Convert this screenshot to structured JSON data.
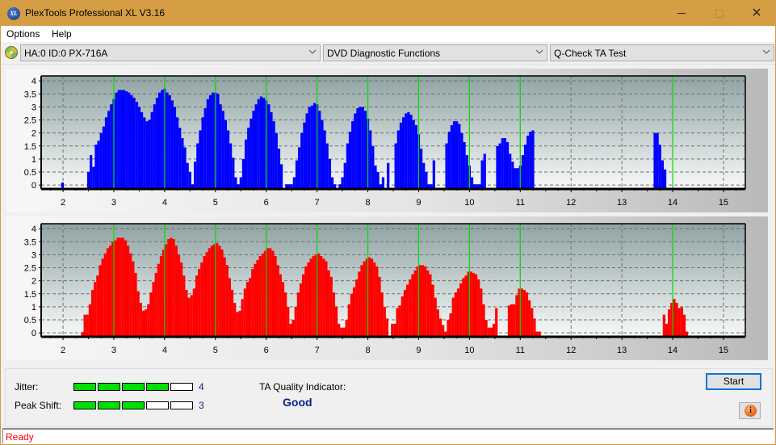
{
  "window": {
    "title": "PlexTools Professional XL V3.16",
    "app_icon": "XL",
    "controls": {
      "minimize": "minimize-icon",
      "maximize": "maximize-icon",
      "close": "×"
    }
  },
  "menu": {
    "items": [
      {
        "label": "Options"
      },
      {
        "label": "Help"
      }
    ]
  },
  "toolbar": {
    "drive": {
      "icon": "disc-drive-icon",
      "value": "HA:0 ID:0  PX-716A"
    },
    "function": {
      "value": "DVD Diagnostic Functions"
    },
    "test": {
      "value": "Q-Check TA Test"
    }
  },
  "results": {
    "jitter": {
      "label": "Jitter:",
      "value": "4",
      "level": 4,
      "max": 5
    },
    "peak_shift": {
      "label": "Peak Shift:",
      "value": "3",
      "level": 3,
      "max": 5
    },
    "ta_quality_label": "TA Quality Indicator:",
    "ta_quality_value": "Good",
    "start_label": "Start",
    "info_icon": "i"
  },
  "status": {
    "text": "Ready"
  },
  "colors": {
    "title_bar": "#d59e43",
    "blue_bars": "#0000ff",
    "red_bars": "#ff0000",
    "reference_lines": "#00e000",
    "meter_on": "#00e000",
    "status_text": "#ff0000",
    "quality_text": "#0d1f8a"
  },
  "chart_data": [
    {
      "type": "bar",
      "title": "",
      "name": "upper-chart",
      "color": "#0000ff",
      "xlabel": "",
      "ylabel": "",
      "xlim": [
        1.57,
        15.43
      ],
      "ylim": [
        -0.15,
        4.19
      ],
      "xticks": [
        2,
        3,
        4,
        5,
        6,
        7,
        8,
        9,
        10,
        11,
        12,
        13,
        14,
        15
      ],
      "yticks": [
        0,
        0.5,
        1,
        1.5,
        2,
        2.5,
        3,
        3.5,
        4
      ],
      "ytick_labels": [
        "0",
        "0.5",
        "1",
        "1.5",
        "2",
        "2.5",
        "3",
        "3.5",
        "4"
      ],
      "grid": true,
      "reference_lines": [
        3,
        4,
        5,
        6,
        7,
        8,
        9,
        10,
        11,
        14
      ],
      "x": [
        1.99,
        2.5,
        2.55,
        2.6,
        2.65,
        2.7,
        2.75,
        2.8,
        2.85,
        2.9,
        2.95,
        3.0,
        3.05,
        3.1,
        3.15,
        3.2,
        3.25,
        3.3,
        3.35,
        3.4,
        3.45,
        3.5,
        3.55,
        3.6,
        3.65,
        3.7,
        3.75,
        3.8,
        3.85,
        3.9,
        3.95,
        4.0,
        4.05,
        4.1,
        4.15,
        4.2,
        4.25,
        4.3,
        4.35,
        4.4,
        4.45,
        4.5,
        4.55,
        4.6,
        4.65,
        4.7,
        4.75,
        4.8,
        4.85,
        4.9,
        4.95,
        5.0,
        5.05,
        5.1,
        5.15,
        5.2,
        5.25,
        5.3,
        5.35,
        5.4,
        5.45,
        5.5,
        5.55,
        5.6,
        5.65,
        5.7,
        5.75,
        5.8,
        5.85,
        5.9,
        5.95,
        6.0,
        6.05,
        6.1,
        6.15,
        6.2,
        6.25,
        6.3,
        6.4,
        6.45,
        6.5,
        6.55,
        6.6,
        6.65,
        6.7,
        6.75,
        6.8,
        6.85,
        6.9,
        6.95,
        7.0,
        7.05,
        7.1,
        7.15,
        7.2,
        7.25,
        7.3,
        7.35,
        7.45,
        7.5,
        7.55,
        7.6,
        7.65,
        7.7,
        7.75,
        7.8,
        7.85,
        7.9,
        7.95,
        8.0,
        8.05,
        8.1,
        8.15,
        8.2,
        8.25,
        8.3,
        8.4,
        8.55,
        8.6,
        8.65,
        8.7,
        8.75,
        8.8,
        8.85,
        8.9,
        8.95,
        9.0,
        9.05,
        9.1,
        9.15,
        9.2,
        9.25,
        9.3,
        9.55,
        9.6,
        9.65,
        9.7,
        9.75,
        9.8,
        9.85,
        9.9,
        9.95,
        10.0,
        10.05,
        10.1,
        10.15,
        10.2,
        10.25,
        10.3,
        10.55,
        10.6,
        10.65,
        10.7,
        10.75,
        10.8,
        10.85,
        10.9,
        10.95,
        11.0,
        11.05,
        11.1,
        11.15,
        11.2,
        11.25,
        13.65,
        13.7,
        13.75,
        13.8,
        13.85,
        13.9,
        13.95,
        14.0,
        14.05,
        14.1,
        14.15
      ],
      "values": [
        0.1,
        0.5,
        1.15,
        0.7,
        1.55,
        1.7,
        2.0,
        2.25,
        2.6,
        2.85,
        3.1,
        3.3,
        3.55,
        3.65,
        3.65,
        3.65,
        3.6,
        3.55,
        3.45,
        3.35,
        3.2,
        3.0,
        2.8,
        2.6,
        2.45,
        2.5,
        2.8,
        3.1,
        3.35,
        3.55,
        3.65,
        3.7,
        3.55,
        3.45,
        3.25,
        3.0,
        2.6,
        2.2,
        1.8,
        1.45,
        0.85,
        0.5,
        0.0,
        0.9,
        1.6,
        2.1,
        2.6,
        2.95,
        3.3,
        3.45,
        3.55,
        3.55,
        3.5,
        3.1,
        2.85,
        2.5,
        2.1,
        1.6,
        1.05,
        0.3,
        0.0,
        0.3,
        1.0,
        1.75,
        2.2,
        2.55,
        2.85,
        3.1,
        3.3,
        3.4,
        3.35,
        3.25,
        3.1,
        2.8,
        2.45,
        2.0,
        1.4,
        0.8,
        0.0,
        0.0,
        0.0,
        0.3,
        0.95,
        1.45,
        2.0,
        2.4,
        2.75,
        3.0,
        3.05,
        3.15,
        3.1,
        2.85,
        2.5,
        2.1,
        1.6,
        1.0,
        0.3,
        0.0,
        0.0,
        0.3,
        0.85,
        1.6,
        2.05,
        2.45,
        2.75,
        2.95,
        3.0,
        3.0,
        2.85,
        2.55,
        2.1,
        1.5,
        0.75,
        0.5,
        0.0,
        0.3,
        0.85,
        1.6,
        2.1,
        2.4,
        2.6,
        2.75,
        2.8,
        2.7,
        2.5,
        2.3,
        1.95,
        1.4,
        0.85,
        0.5,
        0.0,
        0.0,
        0.95,
        1.6,
        2.05,
        2.3,
        2.45,
        2.45,
        2.35,
        2.0,
        1.65,
        1.15,
        0.75,
        0.3,
        0.0,
        0.0,
        0.0,
        0.95,
        1.2,
        1.5,
        1.6,
        1.8,
        1.8,
        1.65,
        1.2,
        0.9,
        0.65,
        0.65,
        0.75,
        1.15,
        1.55,
        1.9,
        2.05,
        2.1,
        2.0,
        2.0,
        1.55,
        0.95,
        0.6
      ]
    },
    {
      "type": "bar",
      "title": "",
      "name": "lower-chart",
      "color": "#ff0000",
      "xlabel": "",
      "ylabel": "",
      "xlim": [
        1.57,
        15.43
      ],
      "ylim": [
        -0.15,
        4.19
      ],
      "xticks": [
        2,
        3,
        4,
        5,
        6,
        7,
        8,
        9,
        10,
        11,
        12,
        13,
        14,
        15
      ],
      "yticks": [
        0,
        0.5,
        1,
        1.5,
        2,
        2.5,
        3,
        3.5,
        4
      ],
      "ytick_labels": [
        "0",
        "0.5",
        "1",
        "1.5",
        "2",
        "2.5",
        "3",
        "3.5",
        "4"
      ],
      "grid": true,
      "reference_lines": [
        3,
        4,
        5,
        6,
        7,
        8,
        9,
        10,
        11,
        14
      ],
      "x": [
        2.38,
        2.43,
        2.48,
        2.53,
        2.58,
        2.63,
        2.68,
        2.73,
        2.78,
        2.83,
        2.88,
        2.93,
        2.98,
        3.03,
        3.08,
        3.13,
        3.18,
        3.23,
        3.28,
        3.33,
        3.38,
        3.43,
        3.48,
        3.53,
        3.58,
        3.63,
        3.68,
        3.73,
        3.78,
        3.83,
        3.88,
        3.93,
        3.98,
        4.03,
        4.08,
        4.13,
        4.18,
        4.23,
        4.28,
        4.33,
        4.38,
        4.43,
        4.48,
        4.53,
        4.58,
        4.63,
        4.68,
        4.73,
        4.78,
        4.83,
        4.88,
        4.93,
        4.98,
        5.03,
        5.08,
        5.13,
        5.18,
        5.23,
        5.28,
        5.33,
        5.38,
        5.43,
        5.48,
        5.53,
        5.58,
        5.63,
        5.68,
        5.73,
        5.78,
        5.83,
        5.88,
        5.93,
        5.98,
        6.03,
        6.08,
        6.13,
        6.18,
        6.23,
        6.28,
        6.33,
        6.38,
        6.43,
        6.48,
        6.53,
        6.58,
        6.63,
        6.68,
        6.73,
        6.78,
        6.83,
        6.88,
        6.93,
        6.98,
        7.03,
        7.08,
        7.13,
        7.18,
        7.23,
        7.28,
        7.33,
        7.38,
        7.43,
        7.48,
        7.53,
        7.58,
        7.63,
        7.68,
        7.73,
        7.78,
        7.83,
        7.88,
        7.93,
        7.98,
        8.03,
        8.08,
        8.13,
        8.18,
        8.23,
        8.28,
        8.33,
        8.38,
        8.48,
        8.53,
        8.58,
        8.63,
        8.68,
        8.73,
        8.78,
        8.83,
        8.88,
        8.93,
        8.98,
        9.03,
        9.08,
        9.13,
        9.18,
        9.23,
        9.28,
        9.33,
        9.38,
        9.43,
        9.48,
        9.53,
        9.58,
        9.63,
        9.68,
        9.73,
        9.78,
        9.83,
        9.88,
        9.93,
        9.98,
        10.03,
        10.08,
        10.13,
        10.18,
        10.23,
        10.28,
        10.33,
        10.38,
        10.43,
        10.48,
        10.53,
        10.78,
        10.83,
        10.88,
        10.93,
        10.98,
        11.03,
        11.08,
        11.13,
        11.18,
        11.23,
        11.28,
        11.33,
        11.38,
        13.83,
        13.88,
        13.93,
        13.98,
        14.03,
        14.08,
        14.13,
        14.18,
        14.23,
        14.28,
        14.33
      ],
      "values": [
        0.0,
        0.7,
        0.7,
        1.1,
        1.65,
        1.95,
        2.2,
        2.6,
        2.85,
        3.05,
        3.25,
        3.35,
        3.5,
        3.55,
        3.65,
        3.65,
        3.65,
        3.55,
        3.35,
        3.05,
        2.75,
        2.3,
        1.6,
        1.15,
        0.85,
        0.9,
        1.1,
        1.55,
        1.95,
        2.3,
        2.65,
        2.95,
        3.2,
        3.4,
        3.6,
        3.65,
        3.6,
        3.35,
        3.0,
        2.7,
        2.2,
        1.65,
        1.35,
        1.45,
        1.7,
        2.2,
        2.45,
        2.7,
        2.95,
        3.1,
        3.25,
        3.35,
        3.4,
        3.45,
        3.35,
        3.2,
        2.9,
        2.6,
        2.1,
        1.65,
        1.15,
        0.8,
        0.85,
        1.3,
        1.7,
        1.95,
        2.1,
        2.45,
        2.65,
        2.8,
        2.95,
        3.05,
        3.15,
        3.25,
        3.25,
        3.15,
        2.95,
        2.6,
        2.25,
        1.95,
        1.55,
        1.0,
        0.35,
        0.5,
        1.0,
        1.55,
        1.9,
        2.25,
        2.55,
        2.7,
        2.85,
        2.95,
        3.0,
        3.05,
        2.95,
        2.85,
        2.75,
        2.4,
        2.15,
        1.55,
        1.0,
        0.35,
        0.2,
        0.2,
        0.5,
        1.1,
        1.5,
        1.75,
        2.05,
        2.35,
        2.6,
        2.75,
        2.85,
        2.9,
        2.85,
        2.7,
        2.55,
        2.15,
        1.55,
        1.0,
        0.55,
        0.35,
        0.35,
        0.95,
        1.05,
        1.4,
        1.65,
        1.85,
        2.05,
        2.25,
        2.4,
        2.55,
        2.6,
        2.6,
        2.55,
        2.4,
        2.25,
        1.85,
        1.35,
        0.9,
        0.55,
        0.3,
        0.05,
        0.5,
        0.75,
        1.35,
        1.55,
        1.7,
        1.9,
        2.1,
        2.2,
        2.35,
        2.35,
        2.3,
        2.25,
        2.05,
        1.7,
        1.1,
        0.5,
        0.2,
        0.2,
        0.35,
        0.95,
        1.05,
        1.1,
        1.1,
        1.45,
        1.7,
        1.7,
        1.65,
        1.55,
        1.25,
        0.95,
        0.55,
        0.05,
        0.05,
        0.7,
        0.35,
        0.9,
        1.15,
        1.3,
        1.15,
        0.95,
        1.0,
        0.7,
        0.05
      ]
    }
  ],
  "x_axis_labels": [
    "2",
    "3",
    "4",
    "5",
    "6",
    "7",
    "8",
    "9",
    "10",
    "11",
    "12",
    "13",
    "14",
    "15"
  ]
}
